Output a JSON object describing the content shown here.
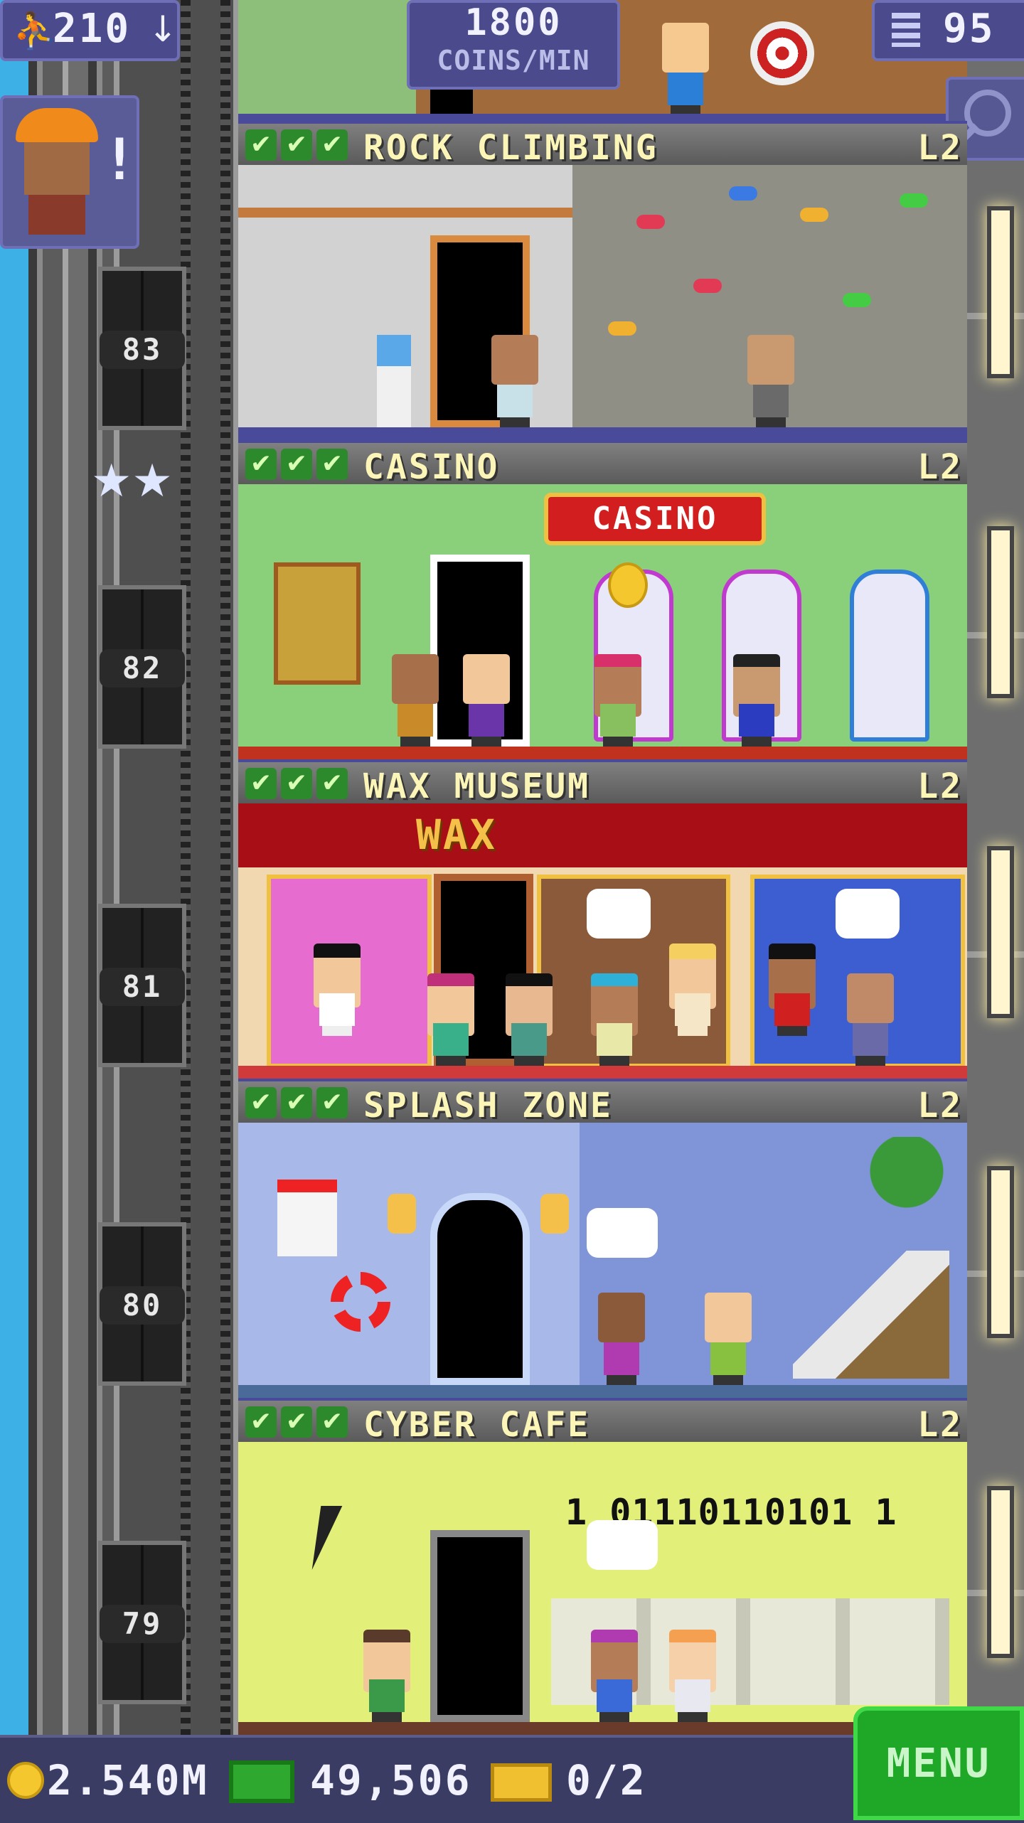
{
  "hud": {
    "population": "210",
    "population_arrow": "↓",
    "coins_rate_value": "1800",
    "coins_rate_unit": "COINS/MIN",
    "floor_count": "95",
    "builder_alert": "!"
  },
  "floors": [
    {
      "name": "ROCK CLIMBING",
      "level": "L2",
      "stars": 3
    },
    {
      "name": "CASINO",
      "level": "L2",
      "stars": 3,
      "sign": "CASINO"
    },
    {
      "name": "WAX MUSEUM",
      "level": "L2",
      "stars": 3,
      "sign": "WAX"
    },
    {
      "name": "SPLASH ZONE",
      "level": "L2",
      "stars": 3
    },
    {
      "name": "CYBER CAFE",
      "level": "L2",
      "stars": 3,
      "screen_text": "1   01110110101 1"
    }
  ],
  "check_glyph": "✔",
  "elevator_floors": [
    "83",
    "82",
    "81",
    "80",
    "79"
  ],
  "bottom": {
    "coins": "2.540M",
    "bux": "49,506",
    "tickets": "0/2",
    "menu_label": "MENU"
  },
  "colors": {
    "accent_green": "#1fa827",
    "label_yellow": "#fbf5b8",
    "hud_purple": "#4a4a8c",
    "sky_blue": "#3fb2e8"
  }
}
